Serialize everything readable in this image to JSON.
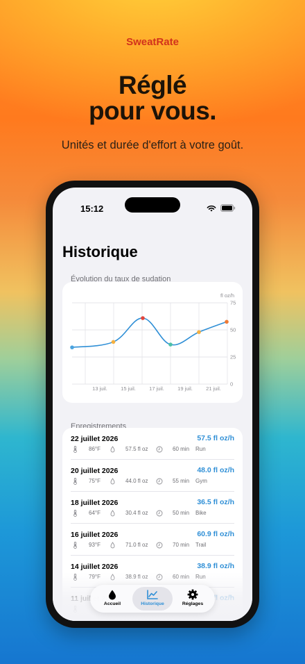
{
  "brand": "SweatRate",
  "hero": {
    "line1": "Réglé",
    "line2": "pour vous."
  },
  "subtitle": "Unités et durée d'effort à votre goût.",
  "phone": {
    "status_time": "15:12",
    "page_title": "Historique",
    "chart_section_label": "Évolution du taux de sudation",
    "recordings_section_label": "Enregistrements",
    "tabs": [
      {
        "label": "Accueil",
        "icon": "drop-icon",
        "active": false
      },
      {
        "label": "Historique",
        "icon": "chart-icon",
        "active": true
      },
      {
        "label": "Réglages",
        "icon": "gear-icon",
        "active": false
      }
    ],
    "records": [
      {
        "date": "22 juillet 2026",
        "temp": "86°F",
        "volume": "57.5 fl oz",
        "duration": "60 min",
        "activity": "Run",
        "rate": "57.5 fl oz/h"
      },
      {
        "date": "20 juillet 2026",
        "temp": "75°F",
        "volume": "44.0 fl oz",
        "duration": "55 min",
        "activity": "Gym",
        "rate": "48.0 fl oz/h"
      },
      {
        "date": "18 juillet 2026",
        "temp": "64°F",
        "volume": "30.4 fl oz",
        "duration": "50 min",
        "activity": "Bike",
        "rate": "36.5 fl oz/h"
      },
      {
        "date": "16 juillet 2026",
        "temp": "93°F",
        "volume": "71.0 fl oz",
        "duration": "70 min",
        "activity": "Trail",
        "rate": "60.9 fl oz/h"
      },
      {
        "date": "14 juillet 2026",
        "temp": "79°F",
        "volume": "38.9 fl oz",
        "duration": "60 min",
        "activity": "Run",
        "rate": "38.9 fl oz/h"
      },
      {
        "date": "11 juillet 2026",
        "temp": "",
        "volume": "",
        "duration": "",
        "activity": "",
        "rate": "fl oz/h"
      }
    ]
  },
  "chart_data": {
    "type": "line",
    "ylabel": "fl oz/h",
    "ylim": [
      0,
      75
    ],
    "yticks": [
      "0",
      "25",
      "50",
      "75"
    ],
    "xticks": [
      "13 juil.",
      "15 juil.",
      "17 juil.",
      "19 juil.",
      "21 juil."
    ],
    "x": [
      "11 juil.",
      "14 juil.",
      "16 juil.",
      "18 juil.",
      "20 juil.",
      "22 juil."
    ],
    "values": [
      33.9,
      38.9,
      60.9,
      36.5,
      48.0,
      57.5
    ],
    "point_colors": [
      "#4aa3df",
      "#f5b040",
      "#e2453c",
      "#4cc0a8",
      "#f5b040",
      "#ef7a35"
    ],
    "line_color": "#2f8fd6",
    "grid": true
  }
}
